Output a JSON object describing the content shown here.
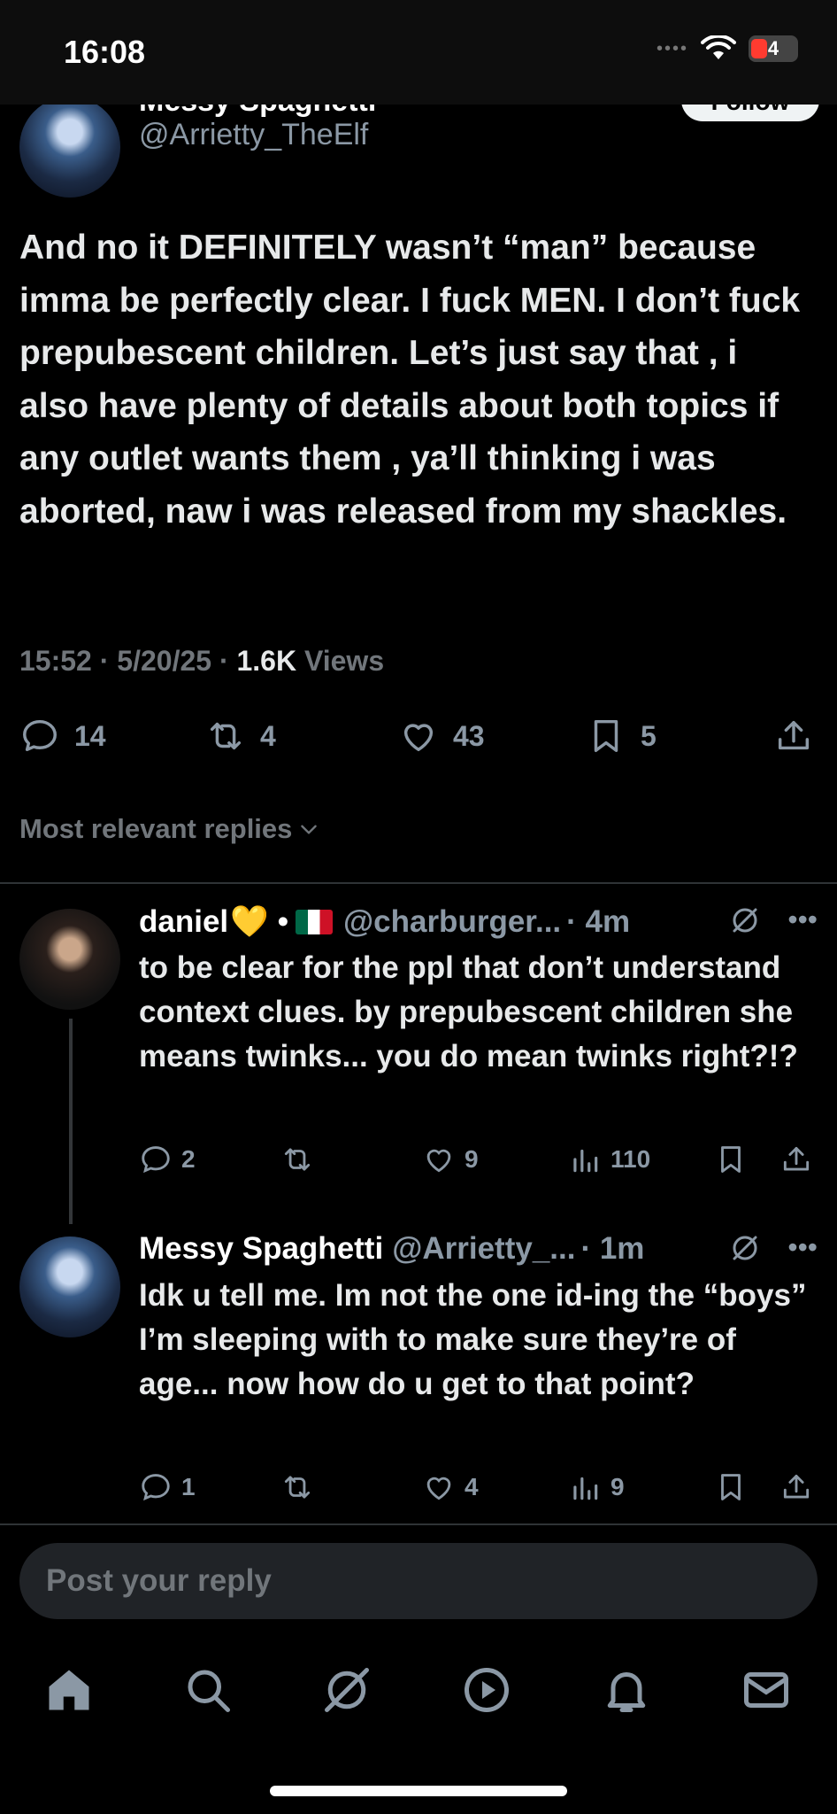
{
  "status_bar": {
    "time": "16:08",
    "battery": "4"
  },
  "author": {
    "name": "Messy Spaghetti",
    "handle": "@Arrietty_TheElf",
    "follow_label": "Follow"
  },
  "tweet": {
    "text": "And no it DEFINITELY wasn’t “man” because imma be perfectly clear. I fuck MEN. I don’t fuck prepubescent children. Let’s just say that , i also have plenty of details about both topics if any outlet wants them , ya’ll thinking i was aborted, naw i was released from my shackles.",
    "time": "15:52",
    "date": "5/20/25",
    "views_count": "1.6K",
    "views_label": "Views",
    "replies": "14",
    "reposts": "4",
    "likes": "43",
    "bookmarks": "5"
  },
  "replies_filter": "Most relevant replies",
  "replies": [
    {
      "name": "daniel",
      "emoji": "💛",
      "bullet": "•",
      "handle": "@charburger...",
      "age": "· 4m",
      "text": "to be clear for the ppl that don’t understand context clues. by prepubescent children she means twinks... you do mean twinks right?!?",
      "replies": "2",
      "reposts": "",
      "likes": "9",
      "views": "110"
    },
    {
      "name": "Messy Spaghetti",
      "handle": "@Arrietty_...",
      "age": "· 1m",
      "text": "Idk u tell me. Im not the one id-ing the “boys” I’m sleeping with to make sure they’re of age... now how do u get to that point?",
      "replies": "1",
      "reposts": "",
      "likes": "4",
      "views": "9"
    }
  ],
  "reply_box": {
    "placeholder": "Post your reply"
  },
  "icons": {
    "reply": "speech-bubble-icon",
    "repost": "repost-icon",
    "like": "heart-icon",
    "bookmark": "bookmark-icon",
    "share": "share-icon",
    "views": "bar-chart-icon",
    "grok": "grok-icon",
    "more": "more-icon"
  }
}
